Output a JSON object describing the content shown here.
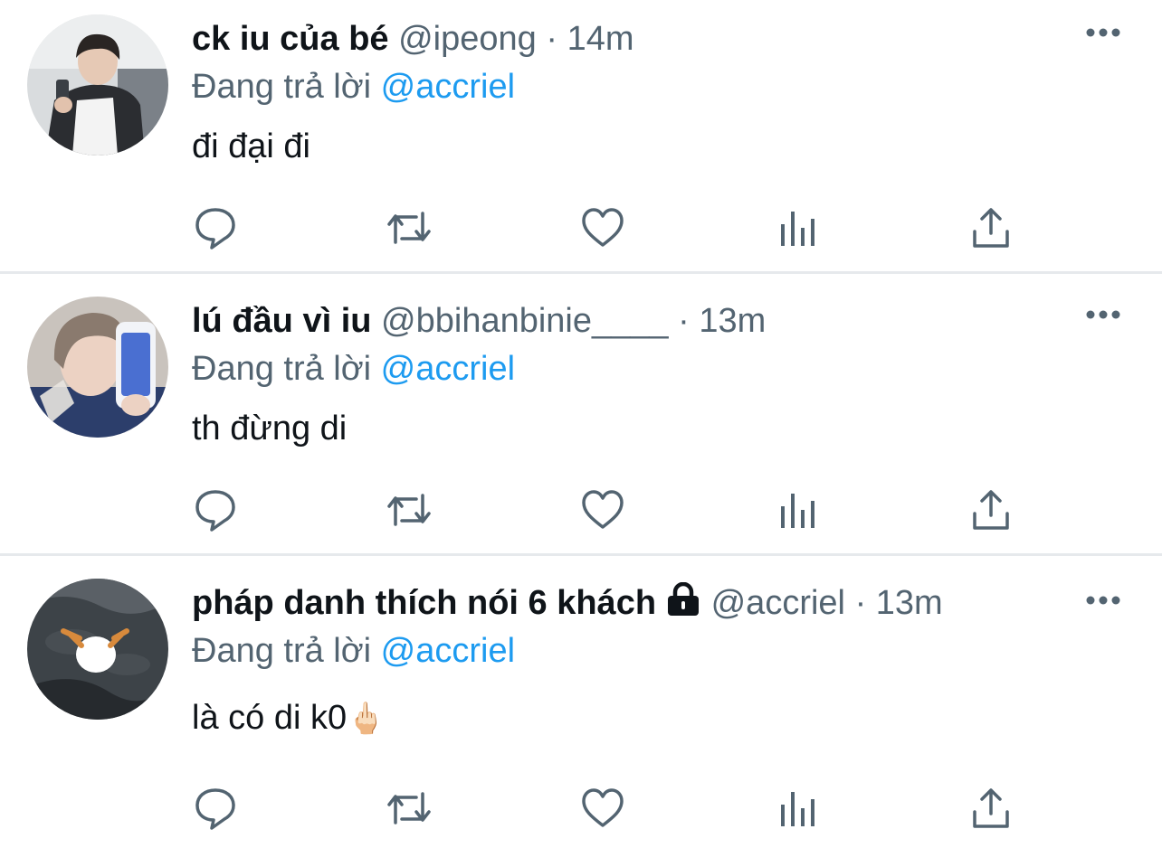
{
  "tweets": [
    {
      "name": "ck iu của bé",
      "handle": "@ipeong",
      "separator": "·",
      "time": "14m",
      "reply_prefix": "Đang trả lời",
      "reply_to": "@accriel",
      "text": "đi đại đi",
      "emoji": "",
      "locked": false
    },
    {
      "name": "lú đầu vì iu",
      "handle": "@bbihanbinie____",
      "separator": "·",
      "time": "13m",
      "reply_prefix": "Đang trả lời",
      "reply_to": "@accriel",
      "text": "th đừng di",
      "emoji": "",
      "locked": false
    },
    {
      "name": "pháp danh thích nói 6 khách",
      "handle": "@accriel",
      "separator": "·",
      "time": "13m",
      "reply_prefix": "Đang trả lời",
      "reply_to": "@accriel",
      "text": "là có di k0",
      "emoji": "🖕🏻",
      "locked": true
    }
  ],
  "icons": [
    "more-icon",
    "reply-icon",
    "retweet-icon",
    "like-icon",
    "analytics-icon",
    "share-icon",
    "lock-icon"
  ],
  "colors": {
    "text": "#0f1419",
    "secondary": "#536471",
    "link": "#1d9bf0",
    "divider": "#e6e9ec"
  }
}
